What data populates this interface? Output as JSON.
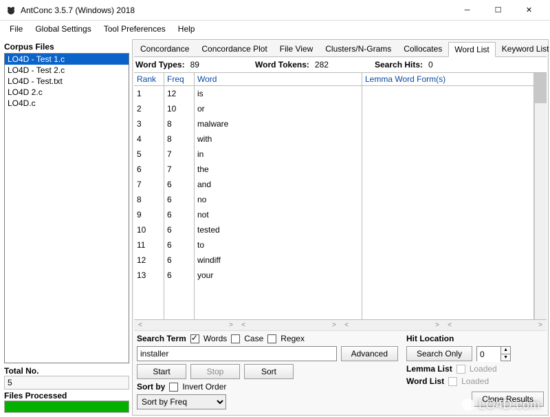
{
  "window": {
    "title": "AntConc 3.5.7 (Windows) 2018"
  },
  "menu": {
    "items": [
      "File",
      "Global Settings",
      "Tool Preferences",
      "Help"
    ]
  },
  "left": {
    "label": "Corpus Files",
    "files": [
      "LO4D - Test 1.c",
      "LO4D - Test 2.c",
      "LO4D - Test.txt",
      "LO4D 2.c",
      "LO4D.c"
    ],
    "selected": 0,
    "total_label": "Total No.",
    "total_value": "5",
    "proc_label": "Files Processed"
  },
  "tabs": {
    "items": [
      "Concordance",
      "Concordance Plot",
      "File View",
      "Clusters/N-Grams",
      "Collocates",
      "Word List",
      "Keyword List"
    ],
    "active": 5
  },
  "stats": {
    "word_types_label": "Word Types:",
    "word_types": "89",
    "word_tokens_label": "Word Tokens:",
    "word_tokens": "282",
    "search_hits_label": "Search Hits:",
    "search_hits": "0"
  },
  "columns": {
    "rank_label": "Rank",
    "freq_label": "Freq",
    "word_label": "Word",
    "lemma_label": "Lemma Word Form(s)",
    "data": [
      {
        "rank": "1",
        "freq": "12",
        "word": "is"
      },
      {
        "rank": "2",
        "freq": "10",
        "word": "or"
      },
      {
        "rank": "3",
        "freq": "8",
        "word": "malware"
      },
      {
        "rank": "4",
        "freq": "8",
        "word": "with"
      },
      {
        "rank": "5",
        "freq": "7",
        "word": "in"
      },
      {
        "rank": "6",
        "freq": "7",
        "word": "the"
      },
      {
        "rank": "7",
        "freq": "6",
        "word": "and"
      },
      {
        "rank": "8",
        "freq": "6",
        "word": "no"
      },
      {
        "rank": "9",
        "freq": "6",
        "word": "not"
      },
      {
        "rank": "10",
        "freq": "6",
        "word": "tested"
      },
      {
        "rank": "11",
        "freq": "6",
        "word": "to"
      },
      {
        "rank": "12",
        "freq": "6",
        "word": "windiff"
      },
      {
        "rank": "13",
        "freq": "6",
        "word": "your"
      }
    ]
  },
  "search": {
    "term_label": "Search Term",
    "words_label": "Words",
    "case_label": "Case",
    "regex_label": "Regex",
    "value": "installer",
    "advanced": "Advanced",
    "start": "Start",
    "stop": "Stop",
    "sort": "Sort",
    "sortby_label": "Sort by",
    "invert_label": "Invert Order",
    "sortby_value": "Sort by Freq"
  },
  "hit": {
    "label": "Hit Location",
    "search_only": "Search Only",
    "value": "0",
    "lemma_label": "Lemma List",
    "word_label": "Word List",
    "loaded": "Loaded",
    "clone": "Clone Results"
  },
  "watermark": "LO4D.com"
}
